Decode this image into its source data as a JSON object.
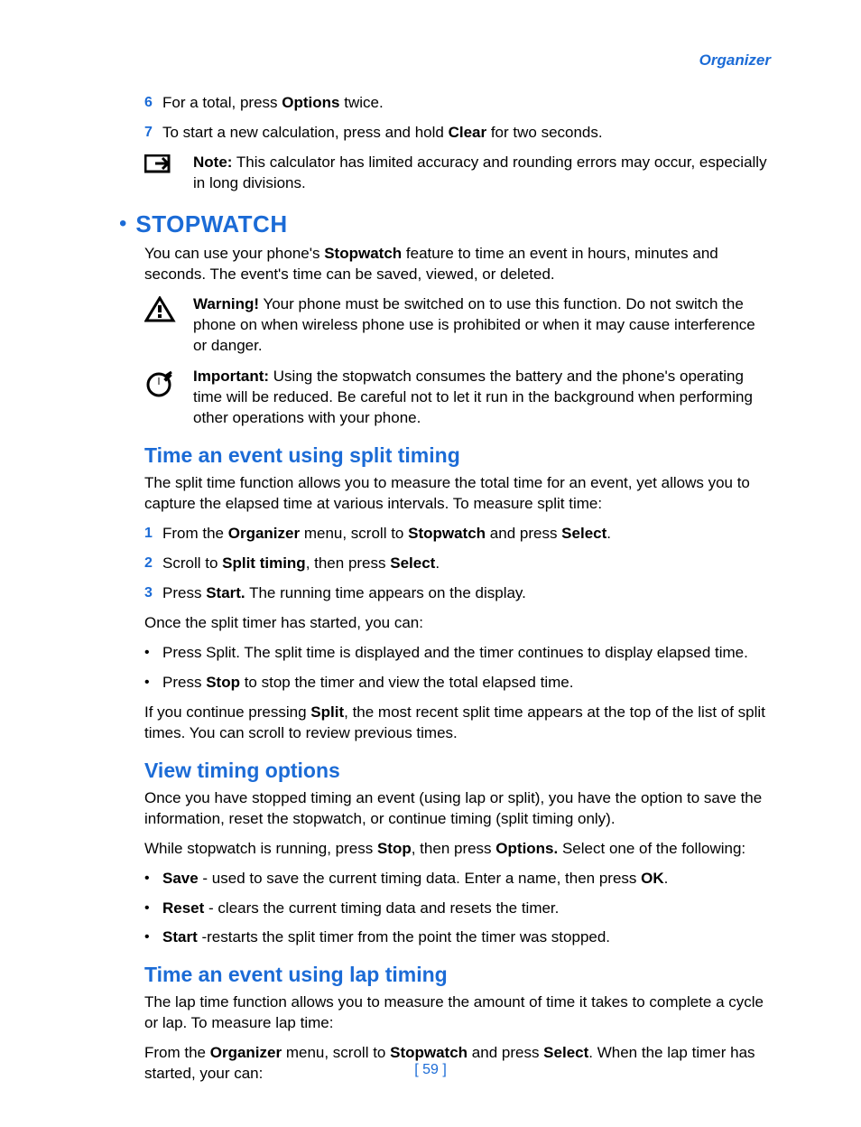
{
  "header": "Organizer",
  "step6": {
    "n": "6",
    "pre": "For a total, press ",
    "b1": "Options",
    "post": " twice."
  },
  "step7": {
    "n": "7",
    "pre": "To start a new calculation, press and hold ",
    "b1": "Clear",
    "post": " for two seconds."
  },
  "note": {
    "label": "Note:",
    "text": " This calculator has limited accuracy and rounding errors may occur, especially in long divisions."
  },
  "stopwatch": {
    "title": "STOPWATCH",
    "intro_pre": "You can use your phone's ",
    "intro_b": "Stopwatch",
    "intro_post": " feature to time an event in hours, minutes and seconds. The event's time can be saved, viewed, or deleted."
  },
  "warning": {
    "label": "Warning!",
    "text": " Your phone must be switched on to use this function. Do not switch the phone on when wireless phone use is prohibited or when it may cause interference or danger."
  },
  "important": {
    "label": "Important:",
    "text": " Using the stopwatch consumes the battery and the phone's operating time will be reduced. Be careful not to let it run in the background when performing other operations with your phone."
  },
  "split": {
    "title": "Time an event using split timing",
    "intro": "The split time function allows you to measure the total time for an event, yet allows you to capture the elapsed time at various intervals. To measure split time:",
    "s1": {
      "n": "1",
      "a": "From the ",
      "b1": "Organizer",
      "b": " menu, scroll to ",
      "b2": "Stopwatch",
      "c": " and press ",
      "b3": "Select",
      "d": "."
    },
    "s2": {
      "n": "2",
      "a": "Scroll to ",
      "b1": "Split timing",
      "b": ", then press ",
      "b2": "Select",
      "c": "."
    },
    "s3": {
      "n": "3",
      "a": "Press ",
      "b1": "Start.",
      "b": " The running time appears on the display."
    },
    "once": "Once the split timer has started, you can:",
    "b1": "Press Split. The split time is displayed and the timer continues to display elapsed time.",
    "b2": {
      "a": "Press ",
      "b1": "Stop",
      "b": " to stop the timer and view the total elapsed time."
    },
    "cont": {
      "a": "If you continue pressing ",
      "b1": "Split",
      "b": ", the most recent split time appears at the top of the list of split times. You can scroll to review previous times."
    }
  },
  "view": {
    "title": "View timing options",
    "intro": "Once you have stopped timing an event (using lap or split), you have the option to save the information, reset the stopwatch, or continue timing (split timing only).",
    "while": {
      "a": "While stopwatch is running, press ",
      "b1": "Stop",
      "b": ", then press ",
      "b2": "Options.",
      "c": " Select one of the following:"
    },
    "i1": {
      "b1": "Save",
      "a": " - used to save the current timing data. Enter a name, then press ",
      "b2": "OK",
      "c": "."
    },
    "i2": {
      "b1": "Reset",
      "a": " - clears the current timing data and resets the timer."
    },
    "i3": {
      "b1": "Start",
      "a": " -restarts the split timer from the point the timer was stopped."
    }
  },
  "lap": {
    "title": "Time an event using lap timing",
    "intro": "The lap time function allows you to measure the amount of time it takes to complete a cycle or lap. To measure lap time:",
    "from": {
      "a": "From the ",
      "b1": "Organizer",
      "b": " menu, scroll to ",
      "b2": "Stopwatch",
      "c": " and press ",
      "b3": "Select",
      "d": ". When the lap timer has started, your can:"
    }
  },
  "pagenum": "[ 59 ]"
}
